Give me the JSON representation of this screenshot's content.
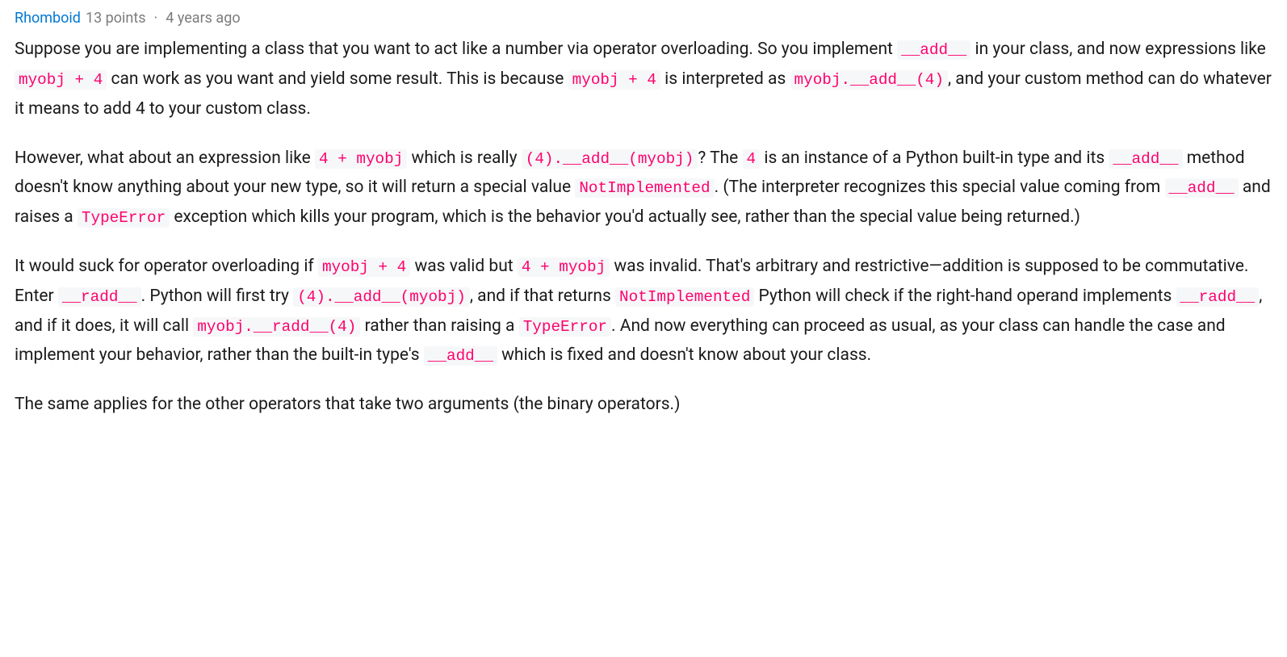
{
  "comment": {
    "author": "Rhomboid",
    "points": "13 points",
    "separator": "·",
    "timestamp": "4 years ago",
    "paragraphs": {
      "p1": {
        "t1": "Suppose you are implementing a class that you want to act like a number via operator overloading. So you implement ",
        "c1": "__add__",
        "t2": " in your class, and now expressions like ",
        "c2": "myobj + 4",
        "t3": " can work as you want and yield some result. This is because ",
        "c3": "myobj + 4",
        "t4": " is interpreted as ",
        "c4": "myobj.__add__(4)",
        "t5": ", and your custom method can do whatever it means to add 4 to your custom class."
      },
      "p2": {
        "t1": "However, what about an expression like ",
        "c1": "4 + myobj",
        "t2": " which is really ",
        "c2": "(4).__add__(myobj)",
        "t3": "? The ",
        "c3": "4",
        "t4": " is an instance of a Python built-in type and its ",
        "c4": "__add__",
        "t5": " method doesn't know anything about your new type, so it will return a special value ",
        "c5": "NotImplemented",
        "t6": ". (The interpreter recognizes this special value coming from ",
        "c6": "__add__",
        "t7": " and raises a ",
        "c7": "TypeError",
        "t8": " exception which kills your program, which is the behavior you'd actually see, rather than the special value being returned.)"
      },
      "p3": {
        "t1": "It would suck for operator overloading if ",
        "c1": "myobj + 4",
        "t2": " was valid but ",
        "c2": "4 + myobj",
        "t3": " was invalid. That's arbitrary and restrictive—addition is supposed to be commutative. Enter ",
        "c3": "__radd__",
        "t4": ". Python will first try ",
        "c4": "(4).__add__(myobj)",
        "t5": ", and if that returns ",
        "c5": "NotImplemented",
        "t6": " Python will check if the right-hand operand implements ",
        "c6": "__radd__",
        "t7": ", and if it does, it will call ",
        "c7": "myobj.__radd__(4)",
        "t8": " rather than raising a ",
        "c8": "TypeError",
        "t9": ". And now everything can proceed as usual, as your class can handle the case and implement your behavior, rather than the built-in type's ",
        "c9": "__add__",
        "t10": " which is fixed and doesn't know about your class."
      },
      "p4": {
        "t1": "The same applies for the other operators that take two arguments (the binary operators.)"
      }
    }
  }
}
